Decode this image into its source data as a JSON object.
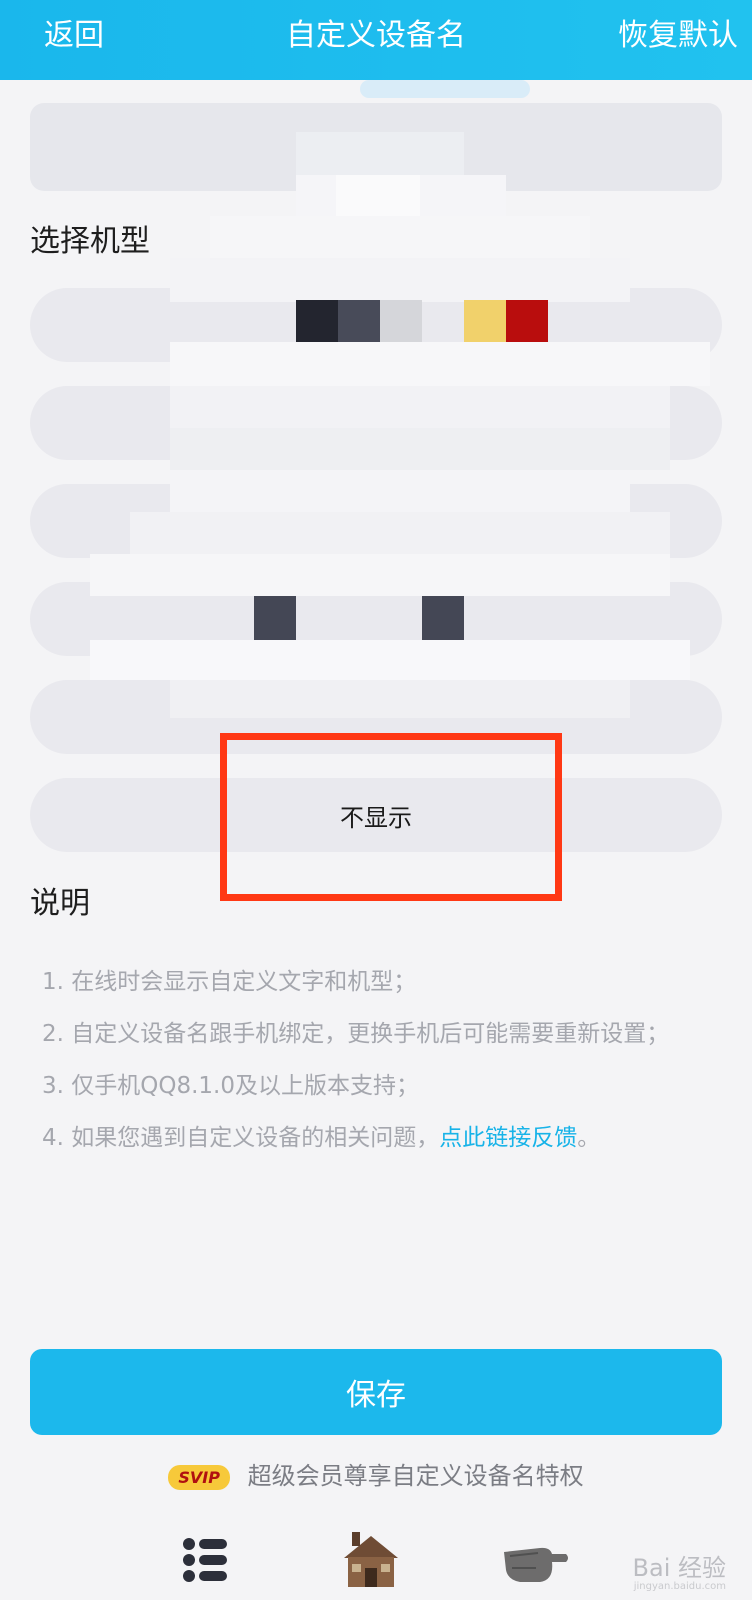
{
  "header": {
    "back_label": "返回",
    "title": "自定义设备名",
    "reset_label": "恢复默认"
  },
  "device_name_input": {
    "value": ""
  },
  "model_section": {
    "title": "选择机型",
    "options": [
      {
        "label": ""
      },
      {
        "label": ""
      },
      {
        "label": ""
      },
      {
        "label": ""
      },
      {
        "label": ""
      },
      {
        "label": "不显示"
      }
    ]
  },
  "notes": {
    "title": "说明",
    "items": [
      "1. 在线时会显示自定义文字和机型；",
      "2. 自定义设备名跟手机绑定，更换手机后可能需要重新设置；",
      "3. 仅手机QQ8.1.0及以上版本支持；"
    ],
    "item4_prefix": "4. 如果您遇到自定义设备的相关问题，",
    "item4_link": "点此链接反馈",
    "item4_suffix": "。"
  },
  "save_label": "保存",
  "svip": {
    "badge": "SVIP",
    "text": "超级会员尊享自定义设备名特权"
  },
  "watermark": {
    "text": "Bai 经验",
    "sub": "jingyan.baidu.com"
  },
  "colors": {
    "header": "#1ab7ec",
    "save_button": "#1cb8ec",
    "link": "#18b3e8",
    "highlight_border": "#ff3814",
    "svip_badge": "#f7c93a"
  }
}
